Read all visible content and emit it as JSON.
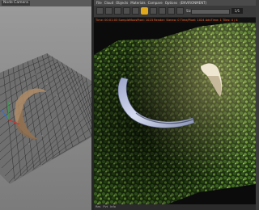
{
  "viewport": {
    "label": "Node Camera"
  },
  "render_window": {
    "menu": [
      "File",
      "Cloud",
      "Objects",
      "Materials",
      "Compare",
      "Options",
      "(ENVIRONMENT)"
    ],
    "toolbar": {
      "label": "Size",
      "zoom": "1/1"
    },
    "status": "Time: 00:01:03 SampleMaxsPixel: 1023 Render: Stereo: 0 Time/Pixel: 1024 AdvTime: 1 Tiles: 4 / 4",
    "bottom_tabs": [
      "Res",
      "Pvt",
      "Info"
    ]
  },
  "colors": {
    "lock_accent": "#e0a81c",
    "status_text": "#ff6a2a"
  }
}
